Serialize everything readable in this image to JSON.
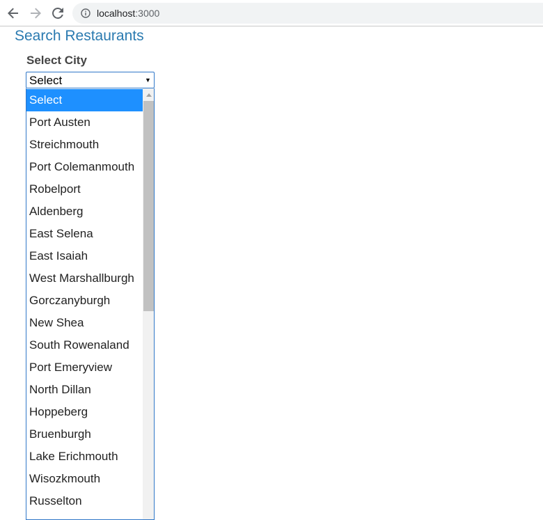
{
  "browser": {
    "url_host": "localhost",
    "url_port": ":3000",
    "icons": [
      "back-arrow-icon",
      "forward-arrow-icon",
      "reload-icon",
      "info-icon"
    ]
  },
  "page": {
    "title": "Search Restaurants",
    "city_label": "Select City"
  },
  "city_select": {
    "selected_value": "Select",
    "options": [
      "Select",
      "Port Austen",
      "Streichmouth",
      "Port Colemanmouth",
      "Robelport",
      "Aldenberg",
      "East Selena",
      "East Isaiah",
      "West Marshallburgh",
      "Gorczanyburgh",
      "New Shea",
      "South Rowenaland",
      "Port Emeryview",
      "North Dillan",
      "Hoppeberg",
      "Bruenburgh",
      "Lake Erichmouth",
      "Wisozkmouth",
      "Russelton"
    ]
  },
  "colors": {
    "title": "#2a7ab0",
    "highlight": "#1e90ff",
    "border": "#2f77c8"
  }
}
